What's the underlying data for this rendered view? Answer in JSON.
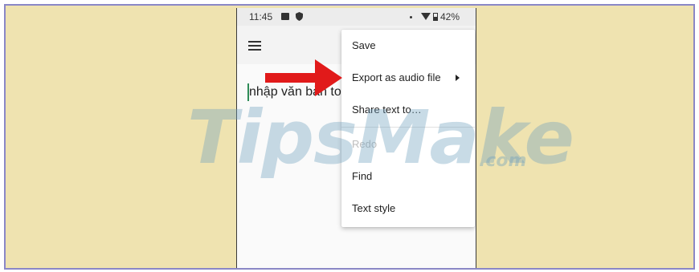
{
  "status_bar": {
    "time": "11:45",
    "battery": "42%"
  },
  "editor": {
    "text": "nhập văn bản to"
  },
  "menu": {
    "items": [
      {
        "label": "Save",
        "enabled": true
      },
      {
        "label": "Export as audio file",
        "enabled": true,
        "has_submenu": true
      },
      {
        "label": "Share text to…",
        "enabled": true
      },
      {
        "label": "Redo",
        "enabled": false
      },
      {
        "label": "Find",
        "enabled": true
      },
      {
        "label": "Text style",
        "enabled": true
      }
    ]
  },
  "watermark": {
    "main": "TipsMake",
    "suffix": ".com"
  },
  "colors": {
    "frame_bg": "#efe3b0",
    "frame_border": "#8a87c6",
    "arrow": "#e11a1a"
  }
}
